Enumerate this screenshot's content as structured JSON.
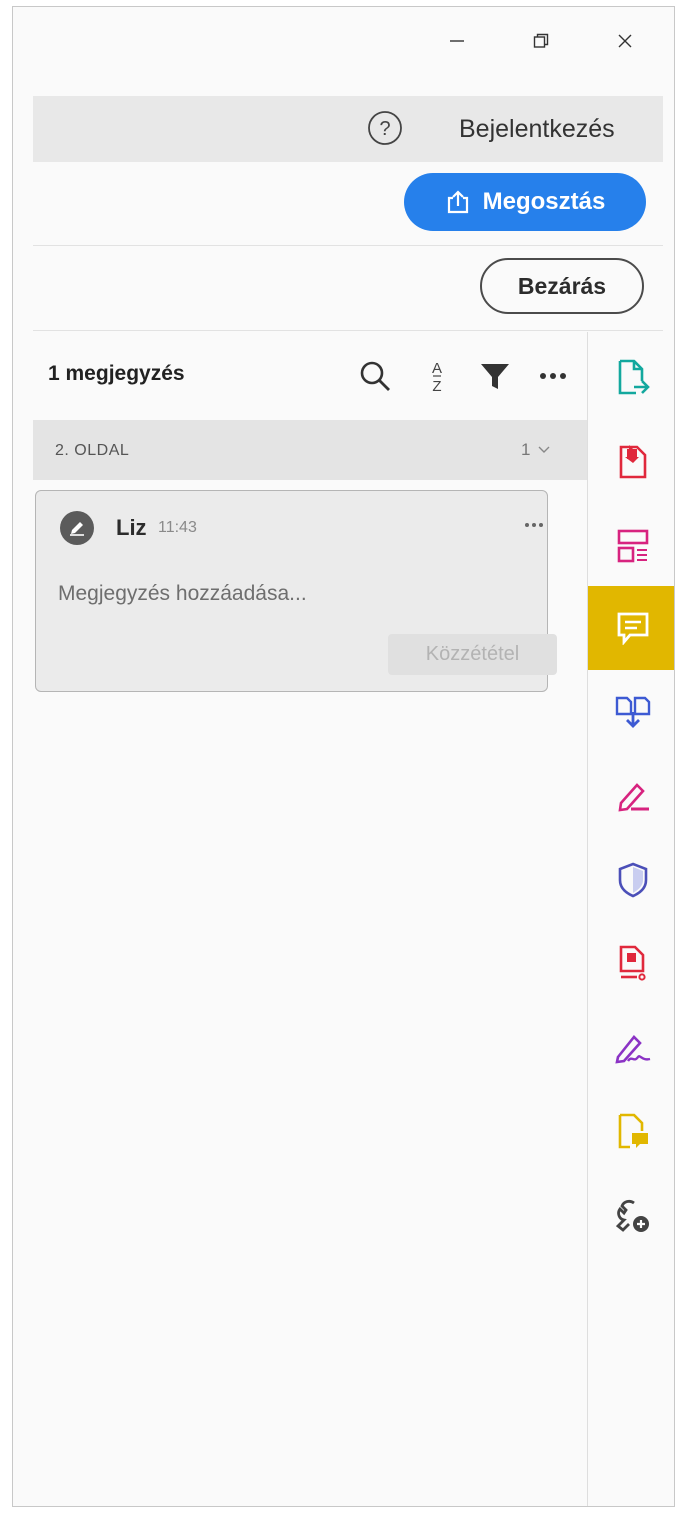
{
  "window": {
    "minimize_icon": "minimize-icon",
    "maximize_icon": "restore-icon",
    "close_icon": "close-icon"
  },
  "header": {
    "help_icon": "help-icon",
    "login_label": "Bejelentkezés",
    "share_label": "Megosztás",
    "share_icon": "share-upload-icon",
    "close_label": "Bezárás"
  },
  "comments_panel": {
    "count_label": "1 megjegyzés",
    "tools": [
      "search-icon",
      "sort-az-icon",
      "filter-icon",
      "more-icon"
    ],
    "page_group": {
      "label": "2. OLDAL",
      "count": "1"
    },
    "comment": {
      "author": "Liz",
      "time": "11:43",
      "placeholder": "Megjegyzés hozzáadása...",
      "post_label": "Közzététel"
    }
  },
  "right_toolbar": {
    "items": [
      {
        "name": "export-pdf-icon",
        "color": "#13a89e"
      },
      {
        "name": "create-pdf-icon",
        "color": "#e0283c"
      },
      {
        "name": "edit-pdf-icon",
        "color": "#d7237f"
      },
      {
        "name": "comment-icon",
        "color": "#ffffff",
        "active": true,
        "active_bg": "#e1b700"
      },
      {
        "name": "combine-files-icon",
        "color": "#3d5ad3"
      },
      {
        "name": "fill-sign-icon",
        "color": "#d7237f"
      },
      {
        "name": "protect-icon",
        "color": "#4b4fb8"
      },
      {
        "name": "compress-pdf-icon",
        "color": "#e0283c"
      },
      {
        "name": "request-signature-icon",
        "color": "#8b33c5"
      },
      {
        "name": "send-for-comments-icon",
        "color": "#e1b700"
      },
      {
        "name": "more-tools-icon",
        "color": "#444444"
      }
    ]
  },
  "colors": {
    "accent": "#2680eb",
    "active_tool": "#e1b700"
  }
}
